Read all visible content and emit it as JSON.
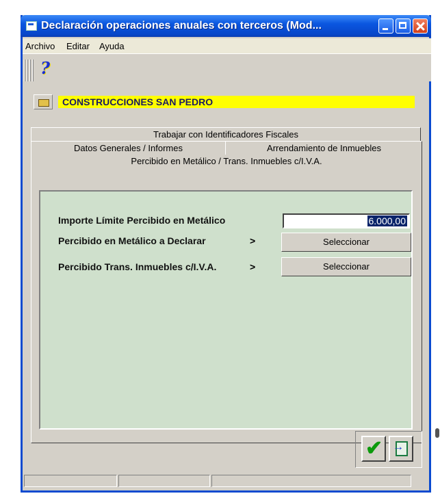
{
  "window": {
    "title": "Declaración operaciones anuales con terceros (Mod..."
  },
  "menu": [
    "Archivo",
    "Editar",
    "Ayuda"
  ],
  "toolbar": {
    "help_icon": "?"
  },
  "company": {
    "name": "CONSTRUCCIONES SAN PEDRO"
  },
  "tabs": {
    "row1": [
      "Trabajar con Identificadores Fiscales"
    ],
    "row2": [
      "Datos Generales / Informes",
      "Arrendamiento de Inmuebles"
    ],
    "active": "Percibido en Metálico / Trans. Inmuebles c/I.V.A."
  },
  "panel": {
    "limit_label": "Importe Límite Percibido en Metálico",
    "limit_value": "6.000,00",
    "cash_label": "Percibido en Metálico a Declarar",
    "cash_arrow": ">",
    "transfer_label": "Percibido Trans. Inmuebles c/I.V.A.",
    "transfer_arrow": ">",
    "select_label": "Seleccionar"
  },
  "icons": {
    "accept": "checkmark-icon",
    "exit": "exit-door-icon",
    "help": "help-question-icon"
  }
}
